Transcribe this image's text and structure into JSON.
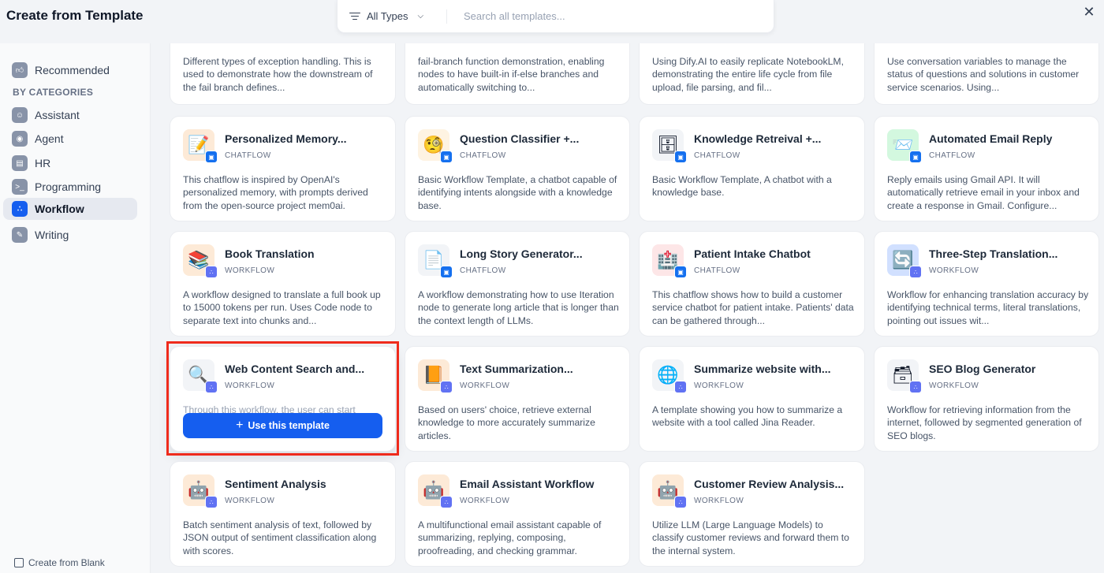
{
  "header": {
    "title": "Create from Template",
    "type_filter": "All Types",
    "search_placeholder": "Search all templates...",
    "close_icon": "close-icon"
  },
  "sidebar": {
    "recommended": "Recommended",
    "categories_label": "BY CATEGORIES",
    "items": [
      {
        "label": "Assistant",
        "icon": "assistant-icon"
      },
      {
        "label": "Agent",
        "icon": "agent-icon"
      },
      {
        "label": "HR",
        "icon": "hr-icon"
      },
      {
        "label": "Programming",
        "icon": "programming-icon"
      },
      {
        "label": "Workflow",
        "icon": "workflow-icon",
        "active": true
      },
      {
        "label": "Writing",
        "icon": "writing-icon"
      }
    ],
    "create_blank": "Create from Blank"
  },
  "types": {
    "chatflow": "CHATFLOW",
    "workflow": "WORKFLOW"
  },
  "top_row": [
    {
      "desc": "Different types of exception handling. This is used to demonstrate how the downstream of the fail branch defines..."
    },
    {
      "desc": "fail-branch function demonstration, enabling nodes to have built-in if-else branches and automatically switching to..."
    },
    {
      "desc": "Using Dify.AI to easily replicate NotebookLM, demonstrating the entire life cycle from file upload, file parsing, and fil..."
    },
    {
      "desc": "Use conversation variables to manage the status of questions and solutions in customer service scenarios. Using..."
    }
  ],
  "rows": [
    [
      {
        "name": "Personalized Memory...",
        "type": "CHATFLOW",
        "emoji": "📝",
        "bg": "#fdead7",
        "desc": "This chatflow is inspired by OpenAI's personalized memory, with prompts derived from the open-source project mem0ai."
      },
      {
        "name": "Question Classifier +...",
        "type": "CHATFLOW",
        "emoji": "🧐",
        "bg": "#fef3e2",
        "desc": "Basic Workflow Template, a chatbot capable of identifying intents alongside with a knowledge base."
      },
      {
        "name": "Knowledge Retreival +...",
        "type": "CHATFLOW",
        "emoji": "🗄️",
        "bg": "#f2f4f7",
        "desc": "Basic Workflow Template, A chatbot with a knowledge base."
      },
      {
        "name": "Automated Email Reply",
        "type": "CHATFLOW",
        "emoji": "📨",
        "bg": "#d3f8df",
        "desc": "Reply emails using Gmail API. It will automatically retrieve email in your inbox and create a response in Gmail. Configure..."
      }
    ],
    [
      {
        "name": "Book Translation",
        "type": "WORKFLOW",
        "emoji": "📚",
        "bg": "#fdead7",
        "desc": "A workflow designed to translate a full book up to 15000 tokens per run. Uses Code node to separate text into chunks and..."
      },
      {
        "name": "Long Story Generator...",
        "type": "CHATFLOW",
        "emoji": "📄",
        "bg": "#f2f4f7",
        "desc": "A workflow demonstrating how to use Iteration node to generate long article that is longer than the context length of LLMs."
      },
      {
        "name": "Patient Intake Chatbot",
        "type": "CHATFLOW",
        "emoji": "🏥",
        "bg": "#fde6e7",
        "desc": "This chatflow shows how to build a customer service chatbot for patient intake. Patients' data can be gathered through..."
      },
      {
        "name": "Three-Step Translation...",
        "type": "WORKFLOW",
        "emoji": "🔄",
        "bg": "#d1e0ff",
        "desc": "Workflow for enhancing translation accuracy by identifying technical terms, literal translations, pointing out issues wit..."
      }
    ],
    [
      {
        "name": "Web Content Search and...",
        "type": "WORKFLOW",
        "emoji": "🔍",
        "bg": "#f2f4f7",
        "desc": "Through this workflow, the user can start"
      },
      {
        "name": "Text Summarization...",
        "type": "WORKFLOW",
        "emoji": "📙",
        "bg": "#fdead7",
        "desc": "Based on users' choice, retrieve external knowledge to more accurately summarize articles."
      },
      {
        "name": "Summarize website with...",
        "type": "WORKFLOW",
        "emoji": "🌐",
        "bg": "#f2f4f7",
        "desc": "A template showing you how to summarize a website with a tool called Jina Reader."
      },
      {
        "name": "SEO Blog Generator",
        "type": "WORKFLOW",
        "emoji": "🗃️",
        "bg": "#f2f4f7",
        "desc": "Workflow for retrieving information from the internet, followed by segmented generation of SEO blogs."
      }
    ],
    [
      {
        "name": "Sentiment Analysis",
        "type": "WORKFLOW",
        "emoji": "🤖",
        "bg": "#fdead7",
        "desc": "Batch sentiment analysis of text, followed by JSON output of sentiment classification along with scores."
      },
      {
        "name": "Email Assistant Workflow",
        "type": "WORKFLOW",
        "emoji": "🤖",
        "bg": "#fdead7",
        "desc": "A multifunctional email assistant capable of summarizing, replying, composing, proofreading, and checking grammar."
      },
      {
        "name": "Customer Review Analysis...",
        "type": "WORKFLOW",
        "emoji": "🤖",
        "bg": "#fdead7",
        "desc": "Utilize LLM (Large Language Models) to classify customer reviews and forward them to the internal system."
      }
    ]
  ],
  "use_template_label": "Use this template"
}
